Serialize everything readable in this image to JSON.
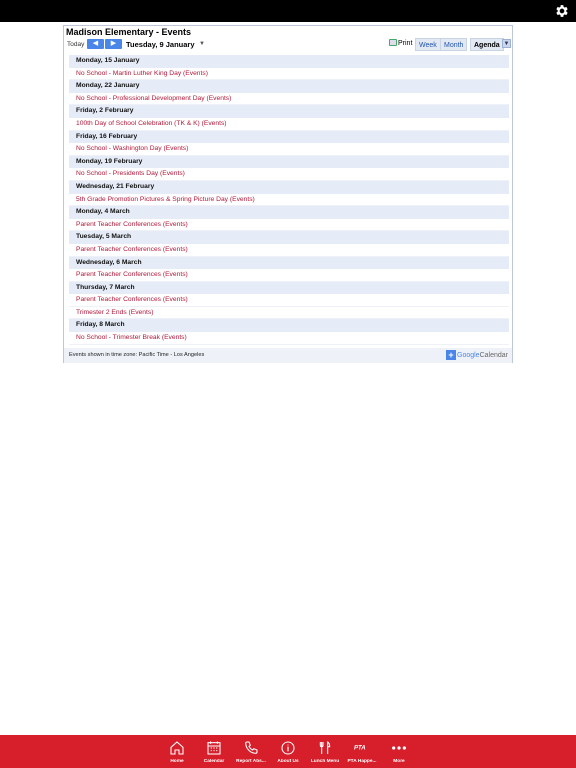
{
  "calendar": {
    "title": "Madison Elementary - Events",
    "today_label": "Today",
    "prev_label": "◀",
    "next_label": "▶",
    "current_date": "Tuesday, 9 January",
    "print_label": "Print",
    "tabs": {
      "week": "Week",
      "month": "Month",
      "agenda": "Agenda"
    },
    "days": [
      {
        "date": "Monday, 15 January",
        "events": [
          "No School - Martin Luther King Day (Events)"
        ]
      },
      {
        "date": "Monday, 22 January",
        "events": [
          "No School - Professional Development Day (Events)"
        ]
      },
      {
        "date": "Friday, 2 February",
        "events": [
          "100th Day of School Celebration (TK & K) (Events)"
        ]
      },
      {
        "date": "Friday, 16 February",
        "events": [
          "No School - Washington Day (Events)"
        ]
      },
      {
        "date": "Monday, 19 February",
        "events": [
          "No School - Presidents Day (Events)"
        ]
      },
      {
        "date": "Wednesday, 21 February",
        "events": [
          "5th Grade Promotion Pictures & Spring Picture Day (Events)"
        ]
      },
      {
        "date": "Monday, 4 March",
        "events": [
          "Parent Teacher Conferences (Events)"
        ]
      },
      {
        "date": "Tuesday, 5 March",
        "events": [
          "Parent Teacher Conferences (Events)"
        ]
      },
      {
        "date": "Wednesday, 6 March",
        "events": [
          "Parent Teacher Conferences (Events)"
        ]
      },
      {
        "date": "Thursday, 7 March",
        "events": [
          "Parent Teacher Conferences (Events)",
          "Trimester 2 Ends (Events)"
        ]
      },
      {
        "date": "Friday, 8 March",
        "events": [
          "No School - Trimester Break (Events)"
        ]
      }
    ],
    "timezone_note": "Events shown in time zone: Pacific Time - Los Angeles",
    "gcal": {
      "google": "Google",
      "calendar": "Calendar"
    }
  },
  "bottom_nav": [
    {
      "label": "Home",
      "icon": "home-icon"
    },
    {
      "label": "Calendar",
      "icon": "calendar-icon"
    },
    {
      "label": "Report Abs...",
      "icon": "phone-icon"
    },
    {
      "label": "About Us",
      "icon": "info-icon"
    },
    {
      "label": "Lunch Menu",
      "icon": "utensils-icon"
    },
    {
      "label": "PTA Happe...",
      "icon": "pta-icon"
    },
    {
      "label": "More",
      "icon": "more-icon"
    }
  ],
  "colors": {
    "brand_red": "#d71e2b",
    "event_text": "#b0193a",
    "day_header_bg": "#e6ecf7",
    "button_blue": "#4a86e8"
  }
}
